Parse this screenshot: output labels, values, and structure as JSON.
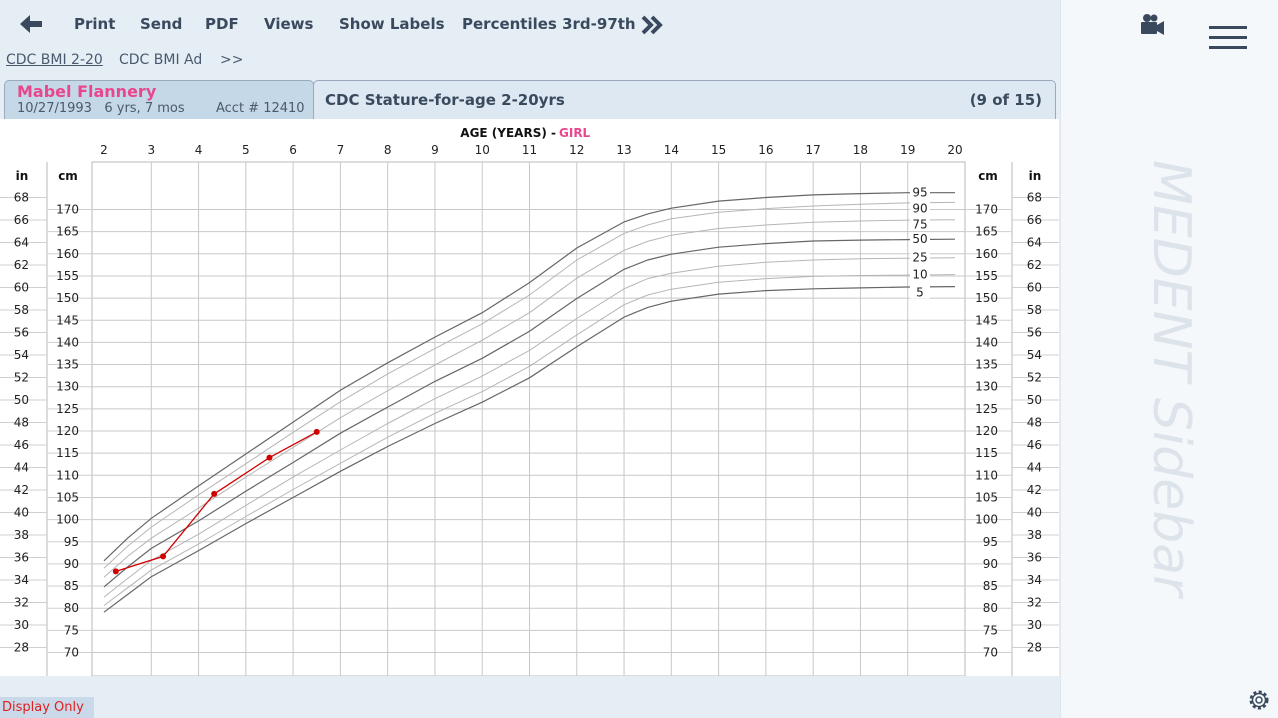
{
  "toolbar": {
    "back_icon": "arrow-left-icon",
    "items": [
      "Print",
      "Send",
      "PDF",
      "Views",
      "Show Labels",
      "Percentiles 3rd-97th"
    ],
    "more_icon": "double-chevron-right-icon"
  },
  "subtabs": [
    "CDC BMI 2-20",
    "CDC BMI Ad",
    ">>"
  ],
  "patient": {
    "name": "Mabel Flannery",
    "dob": "10/27/1993",
    "age": "6 yrs, 7 mos",
    "acct": "Acct # 12410"
  },
  "chart_tab": {
    "title": "CDC Stature-for-age 2-20yrs",
    "page": "(9 of 15)"
  },
  "footer": {
    "display_only": "Display Only"
  },
  "sidebar": {
    "watermark": "MEDENT Sidebar",
    "camera_icon": "video-camera-icon",
    "menu_icon": "hamburger-menu-icon",
    "settings_icon": "gear-icon"
  },
  "colors": {
    "patient_name": "#e8478d",
    "patient_line": "#d00000",
    "display_only": "#e02020"
  },
  "chart_data": {
    "type": "line",
    "title": "AGE (YEARS)",
    "subtitle": "GIRL",
    "xlabel": "AGE (YEARS)",
    "ylabel_left_outer": "in",
    "ylabel_left_inner": "cm",
    "ylabel_right_inner": "cm",
    "ylabel_right_outer": "in",
    "xlim": [
      2,
      20
    ],
    "ylim_cm": [
      66,
      180
    ],
    "x_ticks": [
      2,
      3,
      4,
      5,
      6,
      7,
      8,
      9,
      10,
      11,
      12,
      13,
      14,
      15,
      16,
      17,
      18,
      19,
      20
    ],
    "cm_ticks": [
      70,
      75,
      80,
      85,
      90,
      95,
      100,
      105,
      110,
      115,
      120,
      125,
      130,
      135,
      140,
      145,
      150,
      155,
      160,
      165,
      170
    ],
    "in_ticks": [
      28,
      30,
      32,
      34,
      36,
      38,
      40,
      42,
      44,
      46,
      48,
      50,
      52,
      54,
      56,
      58,
      60,
      62,
      64,
      66,
      68
    ],
    "grid": true,
    "percentile_labels": [
      "95",
      "90",
      "75",
      "50",
      "25",
      "10",
      "5"
    ],
    "ages": [
      2,
      2.5,
      3,
      4,
      5,
      6,
      7,
      8,
      9,
      10,
      11,
      12,
      13,
      13.5,
      14,
      15,
      16,
      17,
      18,
      19,
      20
    ],
    "series": [
      {
        "name": "95",
        "values": [
          90.7,
          95.8,
          100.3,
          107.6,
          114.8,
          122.0,
          129.2,
          135.4,
          141.2,
          146.7,
          153.5,
          161.3,
          167.2,
          169.0,
          170.3,
          171.9,
          172.7,
          173.3,
          173.6,
          173.8,
          173.8
        ]
      },
      {
        "name": "90",
        "values": [
          89.0,
          94.0,
          98.3,
          105.6,
          112.6,
          119.7,
          126.6,
          132.9,
          138.6,
          144.2,
          150.7,
          158.6,
          164.6,
          166.5,
          167.9,
          169.4,
          170.2,
          170.8,
          171.2,
          171.5,
          171.6
        ]
      },
      {
        "name": "75",
        "values": [
          87.0,
          91.7,
          95.8,
          102.6,
          109.6,
          116.3,
          123.0,
          129.1,
          134.9,
          140.5,
          146.7,
          154.5,
          160.8,
          162.8,
          164.2,
          165.7,
          166.5,
          167.1,
          167.4,
          167.6,
          167.7
        ]
      },
      {
        "name": "50",
        "values": [
          84.8,
          89.3,
          93.5,
          99.7,
          106.4,
          112.9,
          119.5,
          125.4,
          131.2,
          136.4,
          142.5,
          149.9,
          156.5,
          158.6,
          159.9,
          161.5,
          162.3,
          162.9,
          163.1,
          163.2,
          163.3
        ]
      },
      {
        "name": "25",
        "values": [
          82.5,
          86.7,
          90.8,
          96.7,
          103.2,
          109.6,
          115.7,
          121.7,
          127.3,
          132.4,
          138.2,
          145.4,
          152.1,
          154.4,
          155.6,
          157.2,
          158.1,
          158.6,
          158.9,
          159.0,
          159.1
        ]
      },
      {
        "name": "10",
        "values": [
          80.6,
          84.6,
          88.6,
          94.5,
          100.7,
          106.8,
          112.7,
          118.6,
          124.0,
          128.9,
          134.6,
          141.7,
          148.5,
          150.7,
          152.0,
          153.6,
          154.4,
          154.9,
          155.1,
          155.2,
          155.3
        ]
      },
      {
        "name": "5",
        "values": [
          79.1,
          83.1,
          87.1,
          93.0,
          99.1,
          105.0,
          110.9,
          116.5,
          121.7,
          126.5,
          132.0,
          139.0,
          145.7,
          147.9,
          149.3,
          150.9,
          151.7,
          152.1,
          152.3,
          152.5,
          152.6
        ]
      }
    ],
    "patient_series": {
      "x": [
        2.25,
        3.25,
        4.33,
        5.5,
        6.5
      ],
      "y": [
        88.3,
        91.7,
        105.8,
        114.0,
        119.8
      ]
    }
  }
}
